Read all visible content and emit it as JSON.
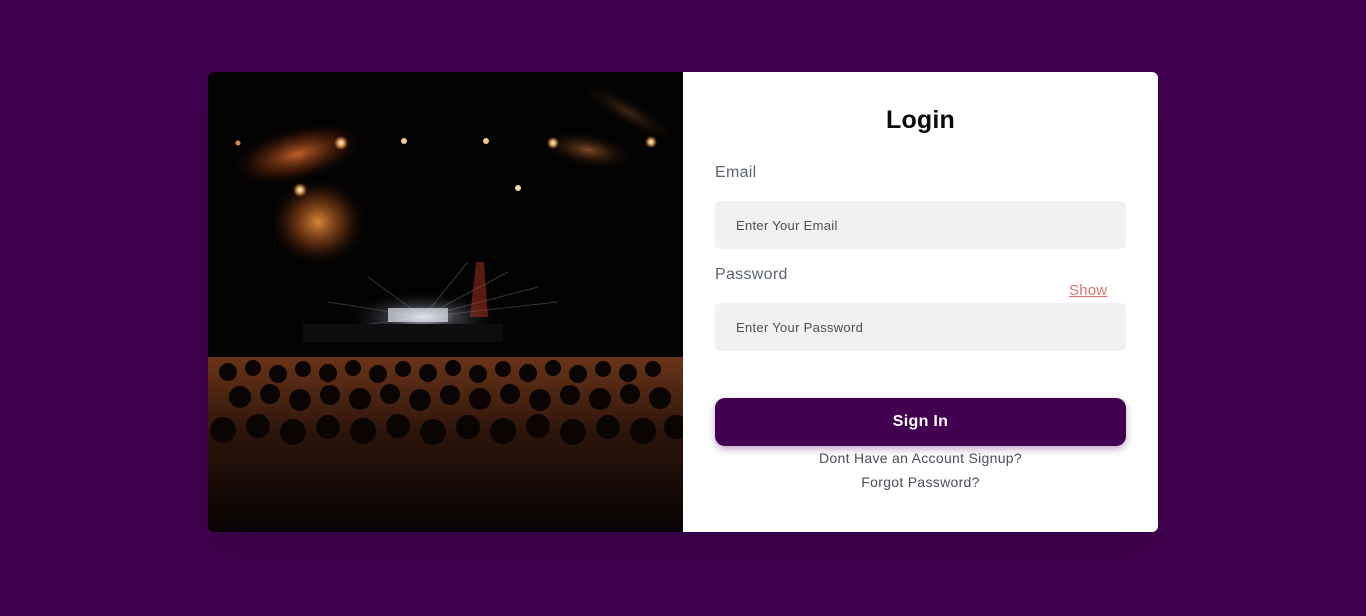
{
  "colors": {
    "page_background": "#430051",
    "primary_button": "#430051",
    "show_link": "#e2706b",
    "input_background": "#f1f1f1"
  },
  "hero_image": {
    "subject": "concert-stage-with-spotlights-and-crowd"
  },
  "login": {
    "title": "Login",
    "email_label": "Email",
    "email_placeholder": "Enter Your Email",
    "password_label": "Password",
    "password_placeholder": "Enter Your Password",
    "show_label": "Show",
    "signin_label": "Sign In",
    "signup_link": "Dont Have an Account Signup?",
    "forgot_link": "Forgot Password?"
  }
}
